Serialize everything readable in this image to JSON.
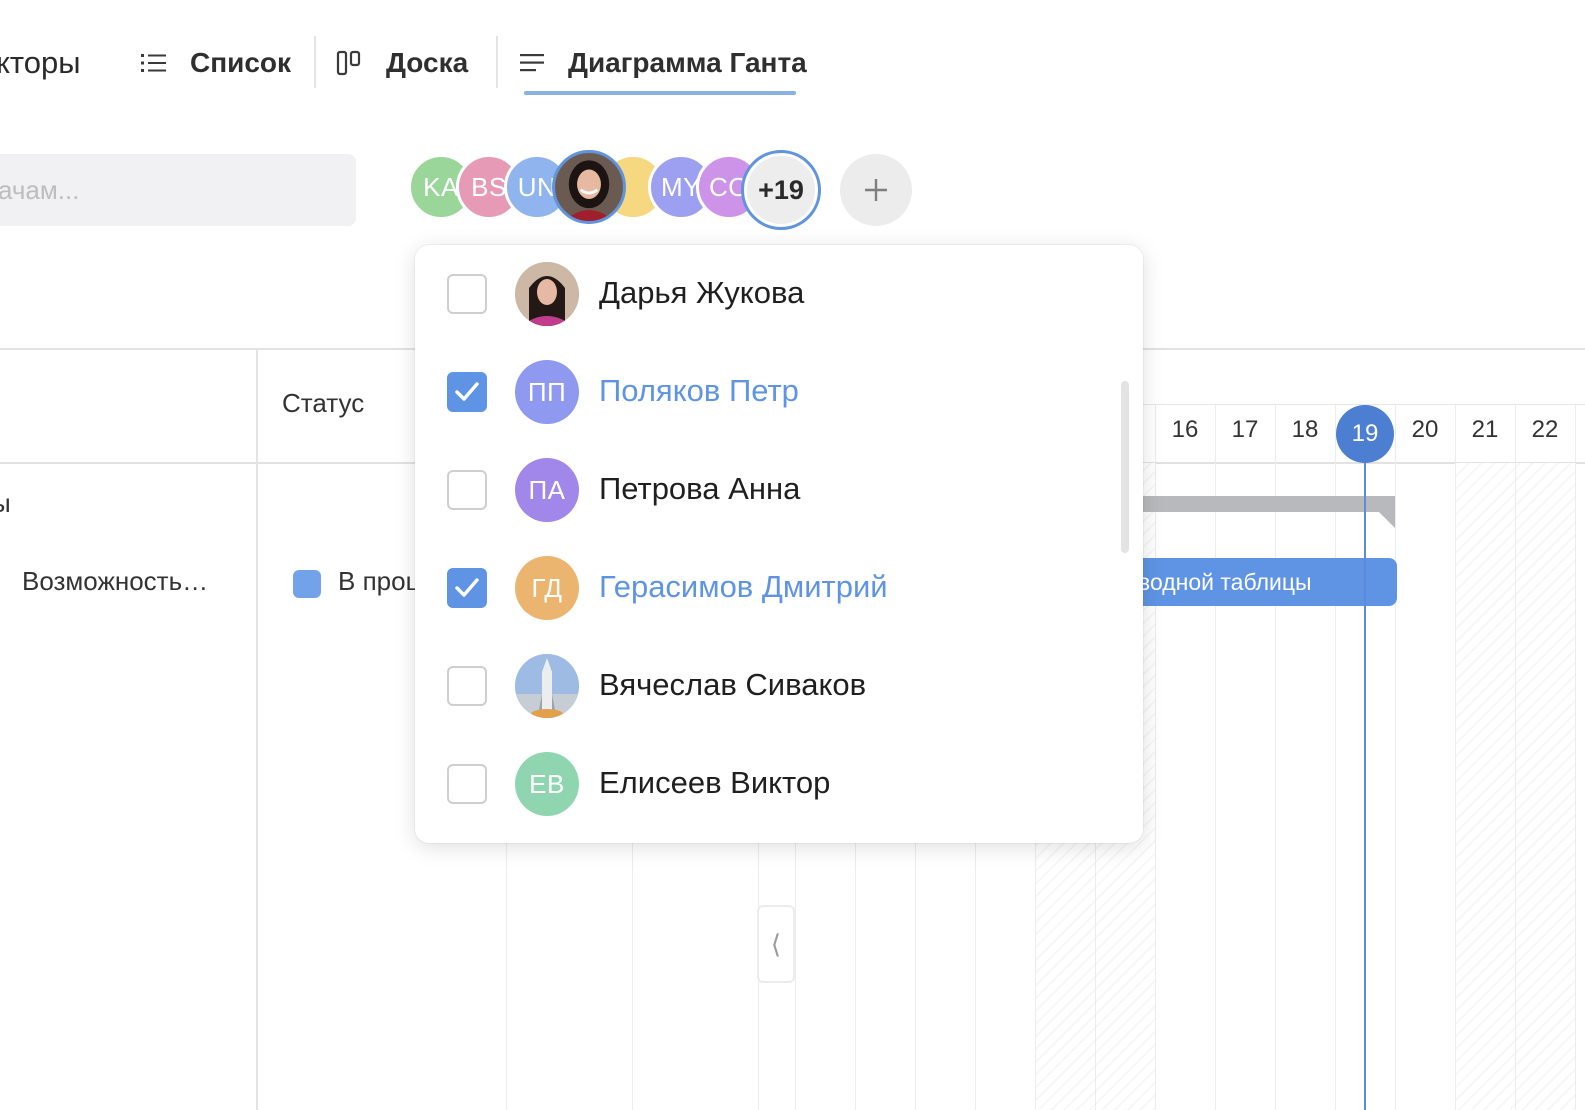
{
  "tabs": {
    "partial_label": "кторы",
    "list_label": "Список",
    "board_label": "Доска",
    "gantt_label": "Диаграмма Ганта",
    "active": "gantt"
  },
  "search": {
    "placeholder": "ачам..."
  },
  "avatar_stack": [
    {
      "initials": "KA",
      "color": "#9ad69a"
    },
    {
      "initials": "BS",
      "color": "#e79ab6"
    },
    {
      "initials": "UN",
      "color": "#8fb4ee"
    },
    {
      "initials": "",
      "photo": true,
      "selected": true
    },
    {
      "initials": "",
      "color": "#f5d880"
    },
    {
      "initials": "MY",
      "color": "#9d9ff0"
    },
    {
      "initials": "CO",
      "color": "#cd93e9"
    }
  ],
  "avatar_more": "+19",
  "add_button_icon": "plus-icon",
  "table": {
    "status_header": "Статус",
    "group_row_partial": "ы",
    "task_name": "Возможность…",
    "task_status": "В процессе",
    "status_color": "#72a3ea"
  },
  "timeline": {
    "days": [
      "16",
      "17",
      "18",
      "19",
      "20",
      "21",
      "22"
    ],
    "today": "19",
    "task_bar_label": "водной таблицы"
  },
  "dropdown": {
    "items": [
      {
        "name": "Дарья Жукова",
        "checked": false,
        "initials": "",
        "photo": "woman-hair"
      },
      {
        "name": "Поляков Петр",
        "checked": true,
        "initials": "ПП",
        "color": "#8e99ef"
      },
      {
        "name": "Петрова Анна",
        "checked": false,
        "initials": "ПА",
        "color": "#a287ea"
      },
      {
        "name": "Герасимов Дмитрий",
        "checked": true,
        "initials": "ГД",
        "color": "#ebb56f"
      },
      {
        "name": "Вячеслав Сиваков",
        "checked": false,
        "initials": "",
        "photo": "rocket"
      },
      {
        "name": "Елисеев Виктор",
        "checked": false,
        "initials": "ЕВ",
        "color": "#8fd6b0"
      }
    ]
  },
  "colors": {
    "accent": "#5f94e4",
    "today": "#4c7fd1"
  }
}
